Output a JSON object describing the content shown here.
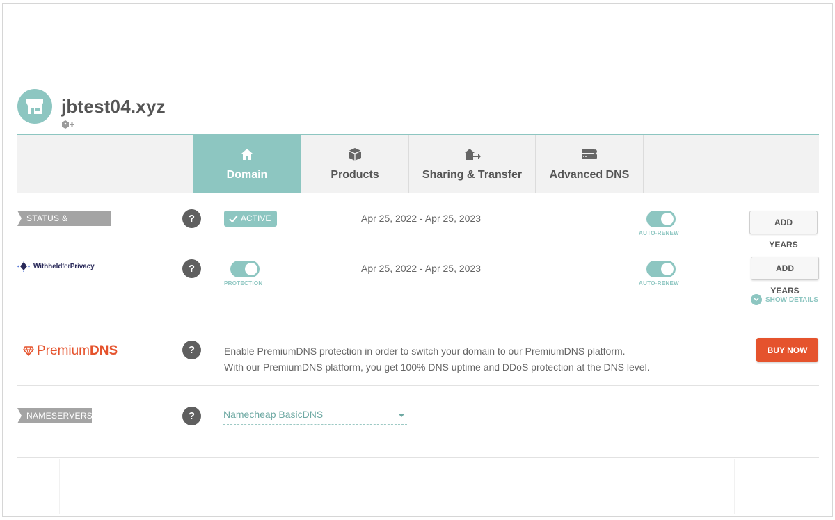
{
  "domain": {
    "name": "jbtest04.xyz",
    "avatar_icon": "storefront-icon",
    "tag_icon": "tag-add-icon"
  },
  "tabs": [
    {
      "label": "Domain",
      "icon": "home-icon",
      "active": true
    },
    {
      "label": "Products",
      "icon": "box-icon",
      "active": false
    },
    {
      "label": "Sharing & Transfer",
      "icon": "house-transfer-icon",
      "active": false
    },
    {
      "label": "Advanced DNS",
      "icon": "server-icon",
      "active": false
    }
  ],
  "status": {
    "ribbon": "STATUS & VALIDITY",
    "badge": "ACTIVE",
    "dates": "Apr 25, 2022 - Apr 25, 2023",
    "auto_renew_label": "AUTO-RENEW",
    "auto_renew_on": true,
    "add_years": "ADD YEARS"
  },
  "privacy": {
    "logo_bold": "Withheld",
    "logo_light": "for",
    "logo_end": "Privacy",
    "protection_label": "PROTECTION",
    "protection_on": true,
    "dates": "Apr 25, 2022 - Apr 25, 2023",
    "auto_renew_label": "AUTO-RENEW",
    "auto_renew_on": true,
    "add_years": "ADD YEARS",
    "show_details": "SHOW DETAILS"
  },
  "premium_dns": {
    "logo_light": "Premium",
    "logo_bold": "DNS",
    "line1": "Enable PremiumDNS protection in order to switch your domain to our PremiumDNS platform.",
    "line2": "With our PremiumDNS platform, you get 100% DNS uptime and DDoS protection at the DNS level.",
    "buy_now": "BUY NOW"
  },
  "nameservers": {
    "ribbon": "NAMESERVERS",
    "selected": "Namecheap BasicDNS"
  },
  "help_symbol": "?",
  "colors": {
    "accent": "#8dc6c1",
    "danger": "#e5532d",
    "ribbon": "#a4a4a4",
    "help": "#5f5f5f"
  }
}
